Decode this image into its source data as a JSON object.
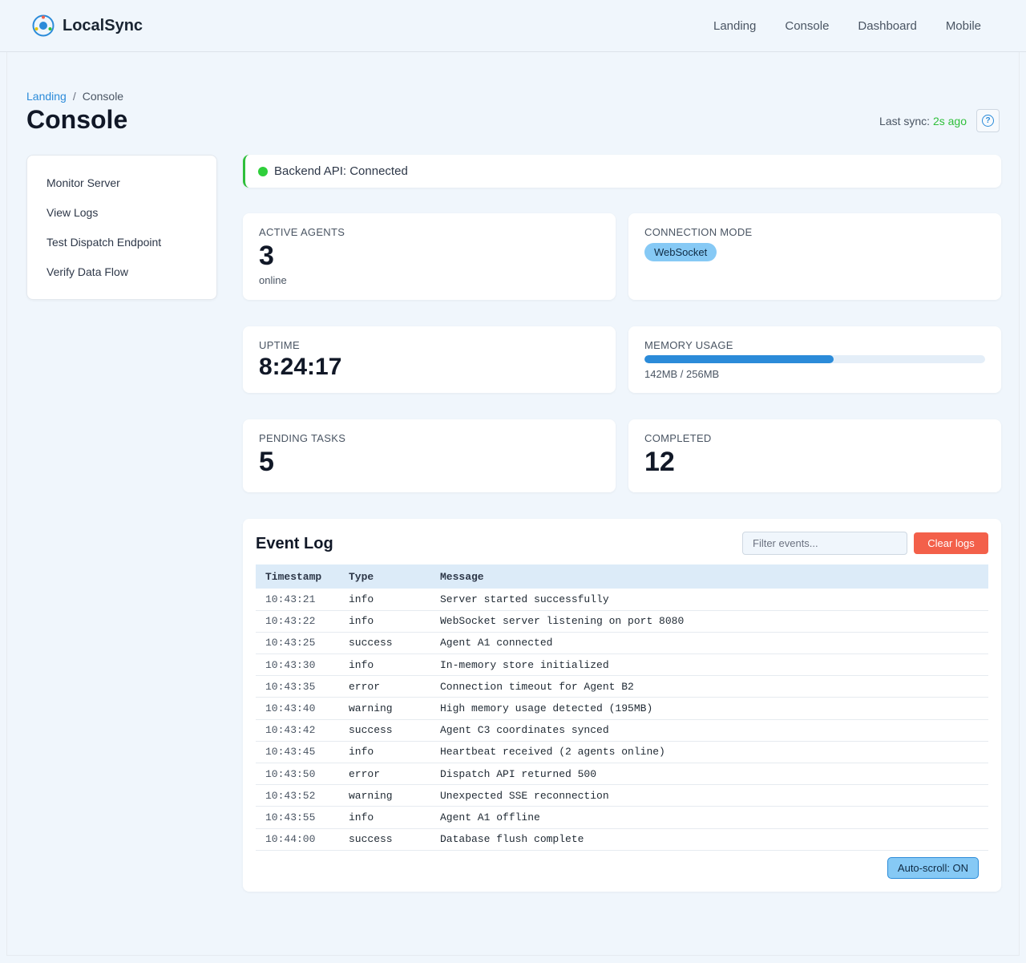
{
  "app": {
    "name": "LocalSync"
  },
  "nav": {
    "items": [
      "Landing",
      "Console",
      "Dashboard",
      "Mobile"
    ]
  },
  "breadcrumb": {
    "parent": "Landing",
    "separator": "/",
    "current": "Console"
  },
  "page": {
    "title": "Console",
    "sync_label": "Last sync:",
    "sync_value": "2s ago"
  },
  "sidebar": {
    "items": [
      "Monitor Server",
      "View Logs",
      "Test Dispatch Endpoint",
      "Verify Data Flow"
    ]
  },
  "status": {
    "text": "Backend API: Connected",
    "color": "#2fcf3b"
  },
  "stats": {
    "active_agents": {
      "label": "ACTIVE AGENTS",
      "value": "3",
      "sub": "online"
    },
    "connection_mode": {
      "label": "CONNECTION MODE",
      "badge": "WebSocket"
    },
    "uptime": {
      "label": "UPTIME",
      "value": "8:24:17"
    },
    "memory": {
      "label": "MEMORY USAGE",
      "text": "142MB / 256MB",
      "fraction": 0.5547
    },
    "pending": {
      "label": "PENDING TASKS",
      "value": "5"
    },
    "completed": {
      "label": "COMPLETED",
      "value": "12"
    }
  },
  "event_log": {
    "title": "Event Log",
    "filter_placeholder": "Filter events...",
    "clear_label": "Clear logs",
    "autoscroll_label": "Auto-scroll: ON",
    "columns": [
      "Timestamp",
      "Type",
      "Message"
    ],
    "rows": [
      {
        "ts": "10:43:21",
        "type": "info",
        "msg": "Server started successfully"
      },
      {
        "ts": "10:43:22",
        "type": "info",
        "msg": "WebSocket server listening on port 8080"
      },
      {
        "ts": "10:43:25",
        "type": "success",
        "msg": "Agent A1 connected"
      },
      {
        "ts": "10:43:30",
        "type": "info",
        "msg": "In-memory store initialized"
      },
      {
        "ts": "10:43:35",
        "type": "error",
        "msg": "Connection timeout for Agent B2"
      },
      {
        "ts": "10:43:40",
        "type": "warning",
        "msg": "High memory usage detected (195MB)"
      },
      {
        "ts": "10:43:42",
        "type": "success",
        "msg": "Agent C3 coordinates synced"
      },
      {
        "ts": "10:43:45",
        "type": "info",
        "msg": "Heartbeat received (2 agents online)"
      },
      {
        "ts": "10:43:50",
        "type": "error",
        "msg": "Dispatch API returned 500"
      },
      {
        "ts": "10:43:52",
        "type": "warning",
        "msg": "Unexpected SSE reconnection"
      },
      {
        "ts": "10:43:55",
        "type": "info",
        "msg": "Agent A1 offline"
      },
      {
        "ts": "10:44:00",
        "type": "success",
        "msg": "Database flush complete"
      }
    ]
  },
  "colors": {
    "accent": "#2b8bd9",
    "success": "#2fbf3b",
    "error": "#e8553f",
    "warning": "#e6c400",
    "danger_button": "#f3604a"
  }
}
